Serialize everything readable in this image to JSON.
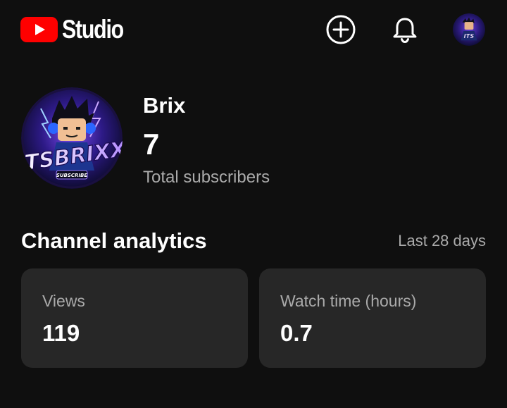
{
  "app": {
    "logo_text": "Studio",
    "brand_color": "#ff0000"
  },
  "topbar": {
    "create_icon": "plus-circle-icon",
    "notifications_icon": "bell-icon"
  },
  "channel": {
    "name": "Brix",
    "subscriber_count": "7",
    "subscriber_label": "Total subscribers",
    "avatar_text": "ITSBRIXX",
    "avatar_subtext": "SUBSCRIBE"
  },
  "analytics": {
    "title": "Channel analytics",
    "period": "Last 28 days",
    "cards": [
      {
        "label": "Views",
        "value": "119"
      },
      {
        "label": "Watch time (hours)",
        "value": "0.7"
      }
    ]
  }
}
